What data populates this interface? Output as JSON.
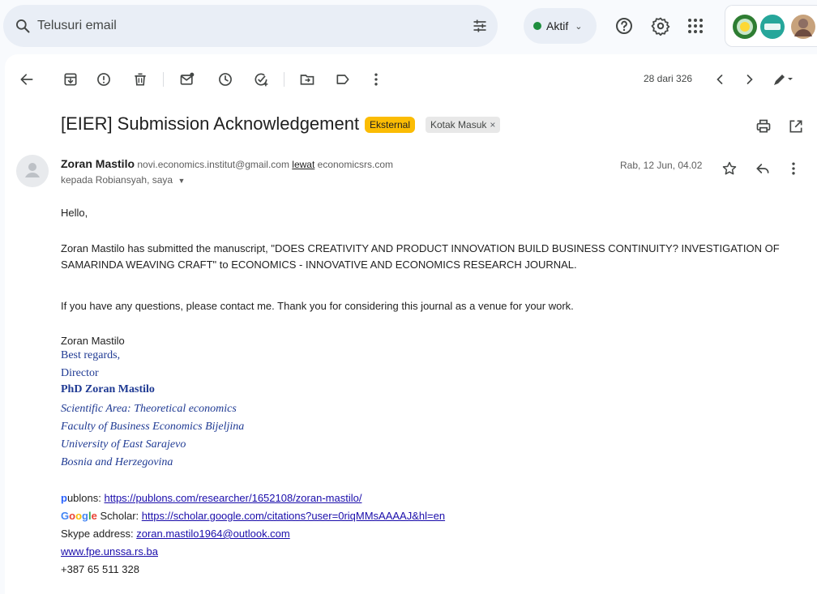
{
  "search": {
    "placeholder": "Telusuri email"
  },
  "status": {
    "label": "Aktif"
  },
  "toolbar": {
    "counter": "28 dari 326"
  },
  "email": {
    "subject": "[EIER] Submission Acknowledgement",
    "labels": {
      "external": "Eksternal",
      "inbox": "Kotak Masuk"
    },
    "sender": {
      "name": "Zoran Mastilo",
      "email": "novi.economics.institut@gmail.com",
      "via_label": "lewat",
      "via_domain": "economicsrs.com"
    },
    "to_line": "kepada Robiansyah, saya",
    "date": "Rab, 12 Jun, 04.02",
    "greeting": "Hello,",
    "paragraph1_line1": "Zoran Mastilo has submitted the manuscript, \"DOES CREATIVITY AND PRODUCT INNOVATION BUILD BUSINESS CONTINUITY? INVESTIGATION OF",
    "paragraph1_line2": "SAMARINDA WEAVING CRAFT\" to ECONOMICS - INNOVATIVE AND ECONOMICS RESEARCH JOURNAL.",
    "paragraph2": "If you have any questions, please contact me. Thank you for considering this journal as a venue for your work.",
    "signature_name": "Zoran Mastilo",
    "sig": {
      "regards": "Best regards,",
      "role": "Director",
      "title_name": "PhD Zoran Mastilo",
      "area": "Scientific Area: Theoretical economics",
      "faculty": "Faculty of Business Economics Bijeljina",
      "university": "University of East Sarajevo",
      "country": "Bosnia and Herzegovina"
    },
    "links": {
      "publons_label_first": "p",
      "publons_label_rest": "ublons: ",
      "publons_url": "https://publons.com/researcher/1652108/zoran-mastilo/",
      "scholar_g1": "G",
      "scholar_o1": "o",
      "scholar_o2": "o",
      "scholar_g2": "g",
      "scholar_l": "l",
      "scholar_e": "e",
      "scholar_label_rest": " Scholar: ",
      "scholar_url": "https://scholar.google.com/citations?user=0riqMMsAAAAJ&hl=en",
      "skype_label": "Skype address: ",
      "skype_email": "zoran.mastilo1964@outlook.com",
      "website": "www.fpe.unssa.rs.ba",
      "phone": "+387 65 511 328"
    }
  },
  "colors": {
    "accent_green": "#1e8e3e",
    "external_label": "#fbbc04",
    "link": "#1a0dab",
    "signature": "#1f3a93"
  },
  "icons": [
    "search-icon",
    "filter-icon",
    "help-icon",
    "settings-icon",
    "apps-icon",
    "back-icon",
    "archive-icon",
    "report-spam-icon",
    "delete-icon",
    "mark-unread-icon",
    "snooze-icon",
    "add-task-icon",
    "move-to-icon",
    "label-icon",
    "more-vert-icon",
    "prev-icon",
    "next-icon",
    "pen-icon",
    "print-icon",
    "open-new-window-icon",
    "star-icon",
    "reply-icon"
  ]
}
